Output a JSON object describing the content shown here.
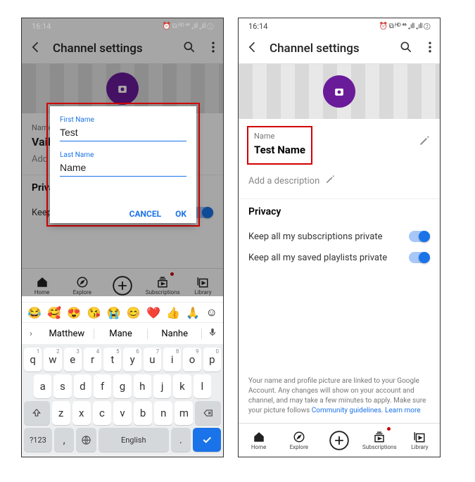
{
  "status": {
    "time": "16:14",
    "indicators": "⏰ ⧉ ᴴᴰ ⁴⁶ ₊ıll ₊ıll ②"
  },
  "header": {
    "title": "Channel settings"
  },
  "left": {
    "name_label": "Name",
    "name_value": "Vail",
    "desc_placeholder": "Add a",
    "privacy_title": "Privacy",
    "privacy_sub": "Keep all my subscriptions private",
    "dialog": {
      "first_label": "First Name",
      "first_value": "Test",
      "last_label": "Last Name",
      "last_value": "Name",
      "cancel": "CANCEL",
      "ok": "OK"
    },
    "suggestions": [
      "Matthew",
      "Mane",
      "Nanhe"
    ],
    "emoji": [
      "😂",
      "🥰",
      "😍",
      "😘",
      "😭",
      "😊",
      "❤️",
      "👍",
      "🙏"
    ],
    "rows": {
      "r1": [
        [
          "q",
          "1"
        ],
        [
          "w",
          "2"
        ],
        [
          "e",
          "3"
        ],
        [
          "r",
          "4"
        ],
        [
          "t",
          "5"
        ],
        [
          "y",
          "6"
        ],
        [
          "u",
          "7"
        ],
        [
          "i",
          "8"
        ],
        [
          "o",
          "9"
        ],
        [
          "p",
          "0"
        ]
      ],
      "r2": [
        "a",
        "s",
        "d",
        "f",
        "g",
        "h",
        "j",
        "k",
        "l"
      ],
      "r3": [
        "z",
        "x",
        "c",
        "v",
        "b",
        "n",
        "m"
      ]
    },
    "space_label": "English",
    "numkey": "?123"
  },
  "right": {
    "name_label": "Name",
    "name_value": "Test Name",
    "desc_placeholder": "Add a description",
    "privacy_title": "Privacy",
    "privacy_rows": [
      "Keep all my subscriptions private",
      "Keep all my saved playlists private"
    ],
    "footnote_a": "Your name and profile picture are linked to your Google Account. Any changes will show on your account and channel, and may take a few minutes to apply. Make sure your picture follows ",
    "footnote_link1": "Community guidelines",
    "footnote_sep": ". ",
    "footnote_link2": "Learn more"
  },
  "nav": {
    "home": "Home",
    "explore": "Explore",
    "subs": "Subscriptions",
    "library": "Library"
  }
}
